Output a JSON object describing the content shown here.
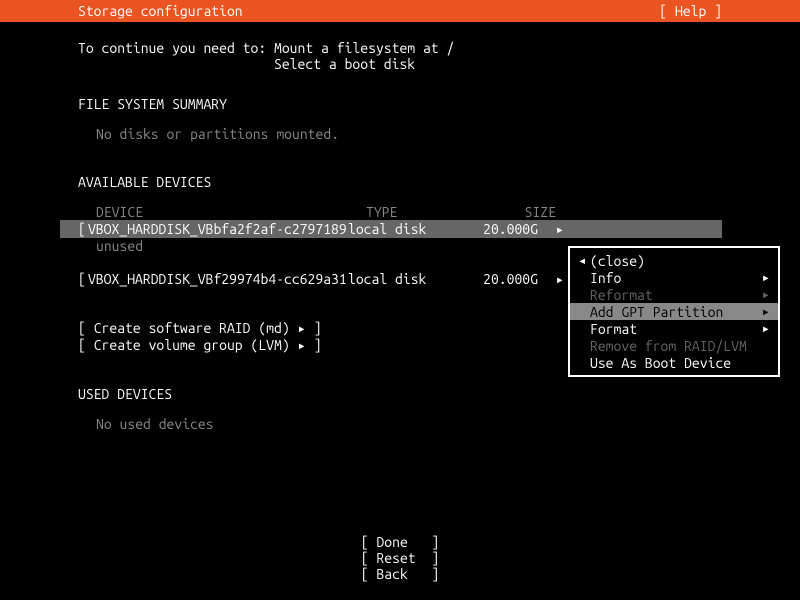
{
  "topbar": {
    "title": "Storage configuration",
    "help": "[ Help ]"
  },
  "instructions": {
    "line1": "To continue you need to: Mount a filesystem at /",
    "line2": "                         Select a boot disk"
  },
  "sections": {
    "fs_summary": "FILE SYSTEM SUMMARY",
    "fs_empty": "No disks or partitions mounted.",
    "available": "AVAILABLE DEVICES",
    "used": "USED DEVICES",
    "used_empty": "No used devices"
  },
  "columns": {
    "device": "DEVICE",
    "type": "TYPE",
    "size": "SIZE"
  },
  "devices": [
    {
      "name": "VBOX_HARDDISK_VBbfa2f2af-c2797189",
      "type": "local disk",
      "size": "20.000G",
      "status": "unused",
      "selected": true
    },
    {
      "name": "VBOX_HARDDISK_VBf29974b4-cc629a31",
      "type": "local disk",
      "size": "20.000G",
      "status": "",
      "selected": false
    }
  ],
  "actions": {
    "raid": "Create software RAID (md) ▸",
    "lvm": "Create volume group (LVM) ▸"
  },
  "buttons": {
    "done": "Done",
    "reset": "Reset",
    "back": "Back"
  },
  "popup": {
    "close": "(close)",
    "items": [
      {
        "label": "Info",
        "enabled": true,
        "submenu": true
      },
      {
        "label": "Reformat",
        "enabled": false,
        "submenu": true
      },
      {
        "label": "Add GPT Partition",
        "enabled": true,
        "submenu": true,
        "highlighted": true
      },
      {
        "label": "Format",
        "enabled": true,
        "submenu": true
      },
      {
        "label": "Remove from RAID/LVM",
        "enabled": false,
        "submenu": false
      },
      {
        "label": "Use As Boot Device",
        "enabled": true,
        "submenu": false
      }
    ]
  },
  "glyphs": {
    "right": "▸",
    "left": "◂"
  }
}
